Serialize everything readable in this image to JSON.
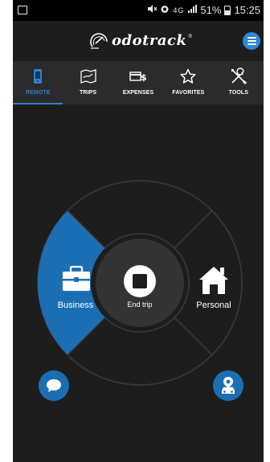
{
  "status_bar": {
    "network": "4G",
    "battery_percent": "51%",
    "time": "15:25"
  },
  "header": {
    "logo_text": "odotrack",
    "logo_mark": "®"
  },
  "tabs": [
    {
      "label": "REMOTE",
      "icon": "phone-remote-icon",
      "active": true
    },
    {
      "label": "TRIPS",
      "icon": "map-icon",
      "active": false
    },
    {
      "label": "EXPENSES",
      "icon": "expenses-icon",
      "active": false
    },
    {
      "label": "FAVORITES",
      "icon": "star-icon",
      "active": false
    },
    {
      "label": "TOOLS",
      "icon": "tools-icon",
      "active": false
    }
  ],
  "wheel": {
    "left_label": "Business",
    "center_label": "End trip",
    "right_label": "Personal",
    "left_icon": "briefcase-icon",
    "center_icon": "stop-icon",
    "right_icon": "home-icon"
  },
  "fabs": {
    "left_icon": "chat-icon",
    "right_icon": "car-location-icon"
  },
  "colors": {
    "accent": "#1c6eb4",
    "tab_active": "#2e7fd0",
    "background": "#1d1d1d"
  }
}
